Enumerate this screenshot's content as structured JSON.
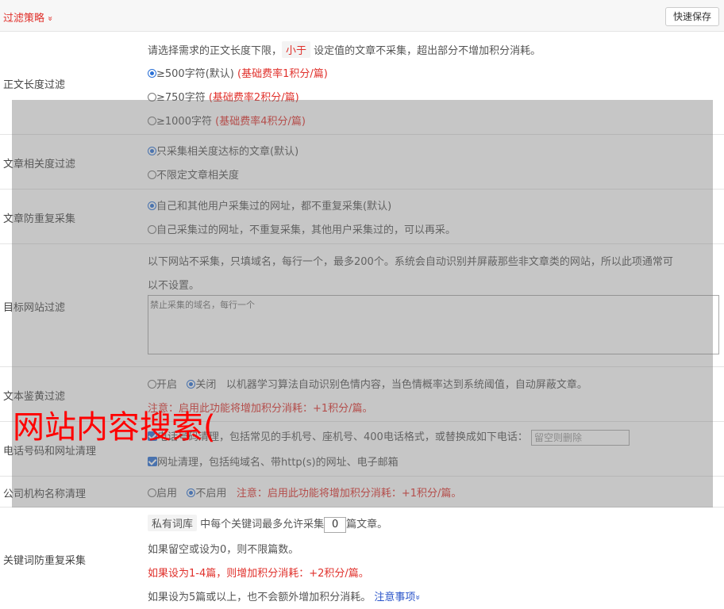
{
  "header": {
    "title": "过滤策略",
    "chevron": "»",
    "save_label": "快速保存"
  },
  "length_filter": {
    "label": "正文长度过滤",
    "desc_pre": "请选择需求的正文长度下限，",
    "desc_tag": "小于",
    "desc_post": "设定值的文章不采集，超出部分不增加积分消耗。",
    "options": [
      {
        "text": "≥500字符(默认)",
        "note": "(基础费率1积分/篇)",
        "selected": true
      },
      {
        "text": "≥750字符",
        "note": "(基础费率2积分/篇)",
        "selected": false
      },
      {
        "text": "≥1000字符",
        "note": "(基础费率4积分/篇)",
        "selected": false
      }
    ]
  },
  "relevance": {
    "label": "文章相关度过滤",
    "options": [
      {
        "text": "只采集相关度达标的文章(默认)",
        "selected": true
      },
      {
        "text": "不限定文章相关度",
        "selected": false
      }
    ]
  },
  "dedupe": {
    "label": "文章防重复采集",
    "options": [
      {
        "text": "自己和其他用户采集过的网址，都不重复采集(默认)",
        "selected": true
      },
      {
        "text": "自己采集过的网址，不重复采集，其他用户采集过的，可以再采。",
        "selected": false
      }
    ]
  },
  "target_sites": {
    "label": "目标网站过滤",
    "desc_line1": "以下网站不采集，只填域名，每行一个，最多200个。系统会自动识别并屏蔽那些非文章类的网站，所以此项通常可",
    "desc_line2": "以不设置。",
    "placeholder": "禁止采集的域名，每行一个"
  },
  "porn_filter": {
    "label": "文本鉴黄过滤",
    "on_label": "开启",
    "off_label": "关闭",
    "desc": "以机器学习算法自动识别色情内容，当色情概率达到系统阈值，自动屏蔽文章。",
    "note": "注意：启用此功能将增加积分消耗：+1积分/篇。"
  },
  "contact_clean": {
    "label": "电话号码和网址清理",
    "phone_text": "电话号码清理，包括常见的手机号、座机号、400电话格式，或替换成如下电话：",
    "phone_placeholder": "留空则删除",
    "url_text": "网址清理，包括纯域名、带http(s)的网址、电子邮箱"
  },
  "org_clean": {
    "label": "公司机构名称清理",
    "on_label": "启用",
    "off_label": "不启用",
    "note": "注意：启用此功能将增加积分消耗：+1积分/篇。"
  },
  "keyword_dedupe": {
    "label": "关键词防重复采集",
    "tag": "私有词库",
    "line1_mid": "中每个关键词最多允许采集",
    "value": "0",
    "line1_post": "篇文章。",
    "line2": "如果留空或设为0，则不限篇数。",
    "line3": "如果设为1-4篇，则增加积分消耗：+2积分/篇。",
    "line4": "如果设为5篇或以上，也不会额外增加积分消耗。",
    "link": "注意事项",
    "link_chevron": "»"
  },
  "watermark": "网站内容搜索("
}
